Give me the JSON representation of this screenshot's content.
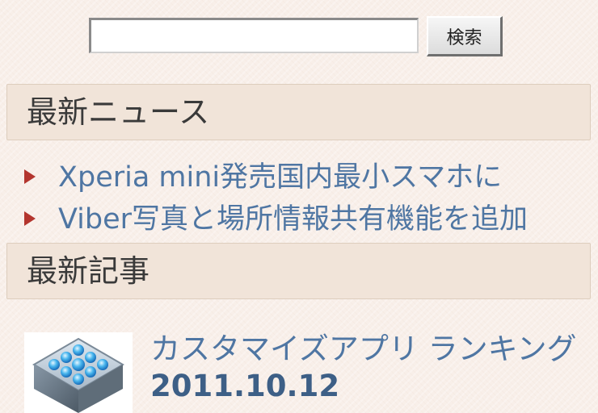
{
  "search": {
    "value": "",
    "button_label": "検索"
  },
  "latest_news": {
    "heading": "最新ニュース",
    "items": [
      {
        "label": "Xperia mini発売国内最小スマホに"
      },
      {
        "label": "Viber写真と場所情報共有機能を追加"
      }
    ]
  },
  "latest_articles": {
    "heading": "最新記事",
    "items": [
      {
        "title": "カスタマイズアプリ ランキング",
        "date": "2011.10.12",
        "thumbnail_icon": "app-grid-icon"
      }
    ]
  },
  "colors": {
    "link": "#4f76a3",
    "bullet": "#b3352e",
    "header_bg": "#f1e4d9",
    "page_bg": "#f8efe9"
  }
}
